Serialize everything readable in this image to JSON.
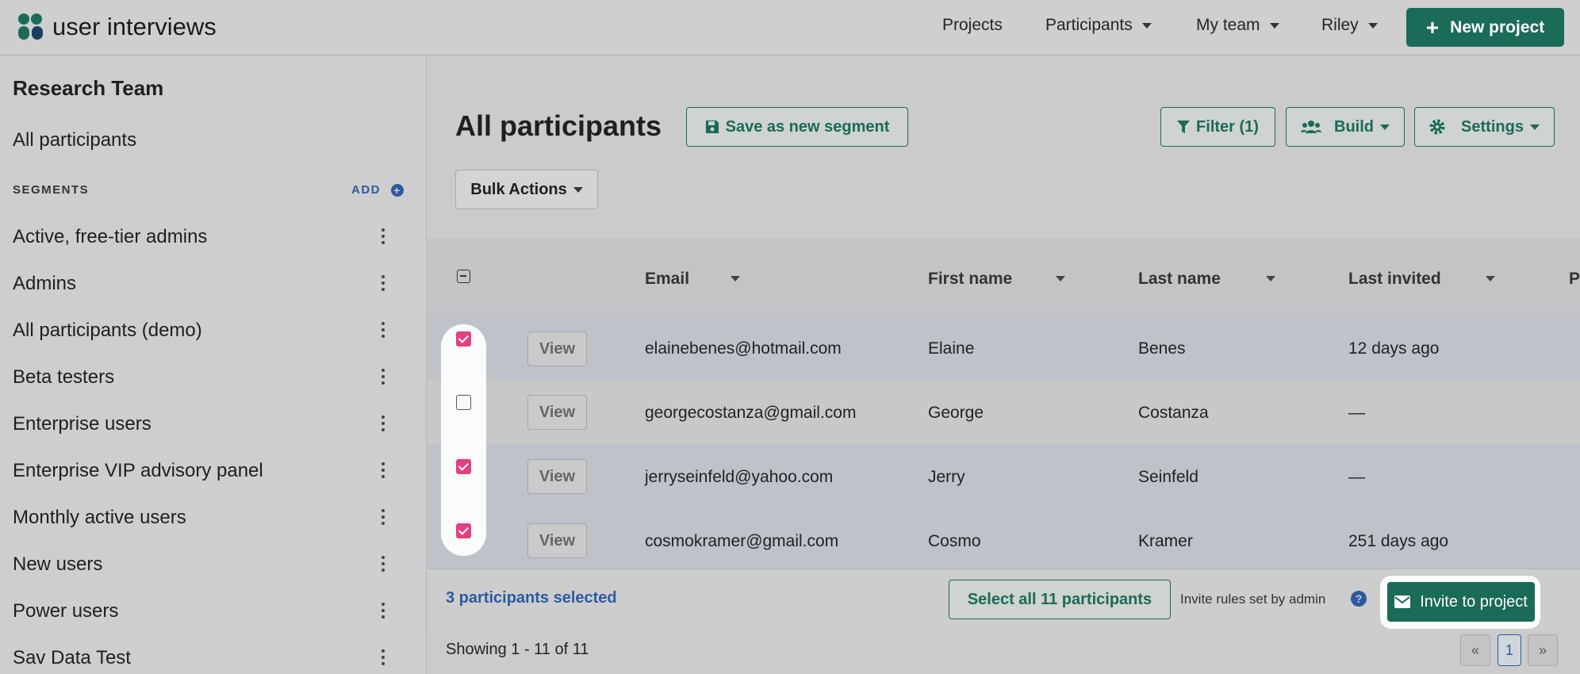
{
  "header": {
    "logo_text": "user interviews",
    "nav": [
      {
        "label": "Projects",
        "dropdown": false
      },
      {
        "label": "Participants",
        "dropdown": true
      },
      {
        "label": "My team",
        "dropdown": true
      },
      {
        "label": "Riley",
        "dropdown": true
      }
    ],
    "new_project_label": "New project"
  },
  "sidebar": {
    "team_title": "Research Team",
    "all_participants": "All participants",
    "segments_heading": "SEGMENTS",
    "add_label": "ADD",
    "segments": [
      "Active, free-tier admins",
      "Admins",
      "All participants (demo)",
      "Beta testers",
      "Enterprise users",
      "Enterprise VIP advisory panel",
      "Monthly active users",
      "New users",
      "Power users",
      "Sav Data Test"
    ]
  },
  "main": {
    "title": "All participants",
    "save_segment_label": "Save as new segment",
    "filter_label": "Filter (1)",
    "build_label": "Build",
    "settings_label": "Settings",
    "bulk_actions_label": "Bulk Actions",
    "columns": [
      "Email",
      "First name",
      "Last name",
      "Last invited",
      "P"
    ],
    "view_label": "View",
    "rows": [
      {
        "selected": true,
        "email": "elainebenes@hotmail.com",
        "first": "Elaine",
        "last": "Benes",
        "invited": "12 days ago"
      },
      {
        "selected": false,
        "email": "georgecostanza@gmail.com",
        "first": "George",
        "last": "Costanza",
        "invited": "—"
      },
      {
        "selected": true,
        "email": "jerryseinfeld@yahoo.com",
        "first": "Jerry",
        "last": "Seinfeld",
        "invited": "—"
      },
      {
        "selected": true,
        "email": "cosmokramer@gmail.com",
        "first": "Cosmo",
        "last": "Kramer",
        "invited": "251 days ago"
      }
    ],
    "selected_count_label": "3 participants selected",
    "select_all_label": "Select all 11 participants",
    "invite_note": "Invite rules set by admin",
    "help_glyph": "?",
    "invite_label": "Invite to project",
    "showing_label": "Showing 1 - 11 of 11",
    "pagination": {
      "first": "«",
      "current": "1",
      "next": "»"
    }
  },
  "colors": {
    "brand_green": "#1a6b57",
    "link_blue": "#2c5aa0",
    "checkbox_pink": "#e43f7e"
  }
}
